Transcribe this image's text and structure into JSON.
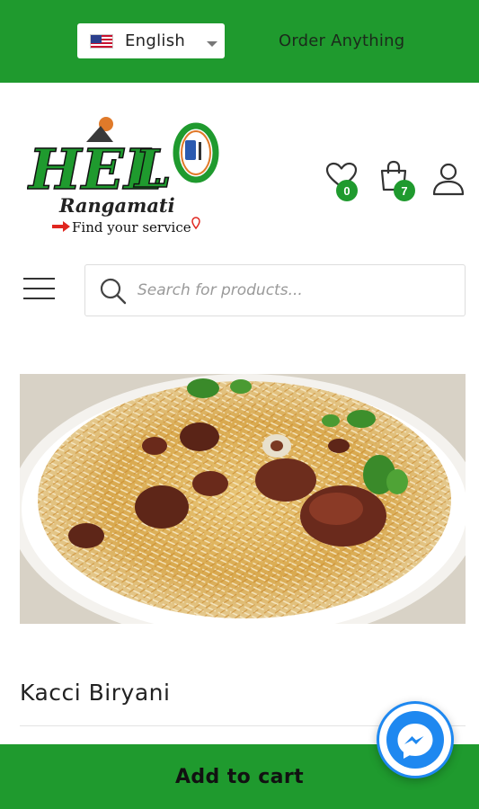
{
  "topbar": {
    "language": {
      "selected": "English",
      "flag": "us-flag-icon"
    },
    "order_link": "Order Anything",
    "color": "#1f9a2e"
  },
  "logo": {
    "brand": "HELLO",
    "subtitle": "Rangamati",
    "tagline": "Find your service"
  },
  "header_icons": {
    "wishlist": {
      "icon": "heart-icon",
      "count": "0"
    },
    "cart": {
      "icon": "shopping-bag-icon",
      "count": "7"
    },
    "account": {
      "icon": "user-icon"
    }
  },
  "search": {
    "placeholder": "Search for products..."
  },
  "product": {
    "title": "Kacci Biryani",
    "image": "biryani-photo"
  },
  "add_to_cart_label": "Add to cart",
  "messenger": {
    "icon": "messenger-icon",
    "color": "#1e88f0"
  }
}
